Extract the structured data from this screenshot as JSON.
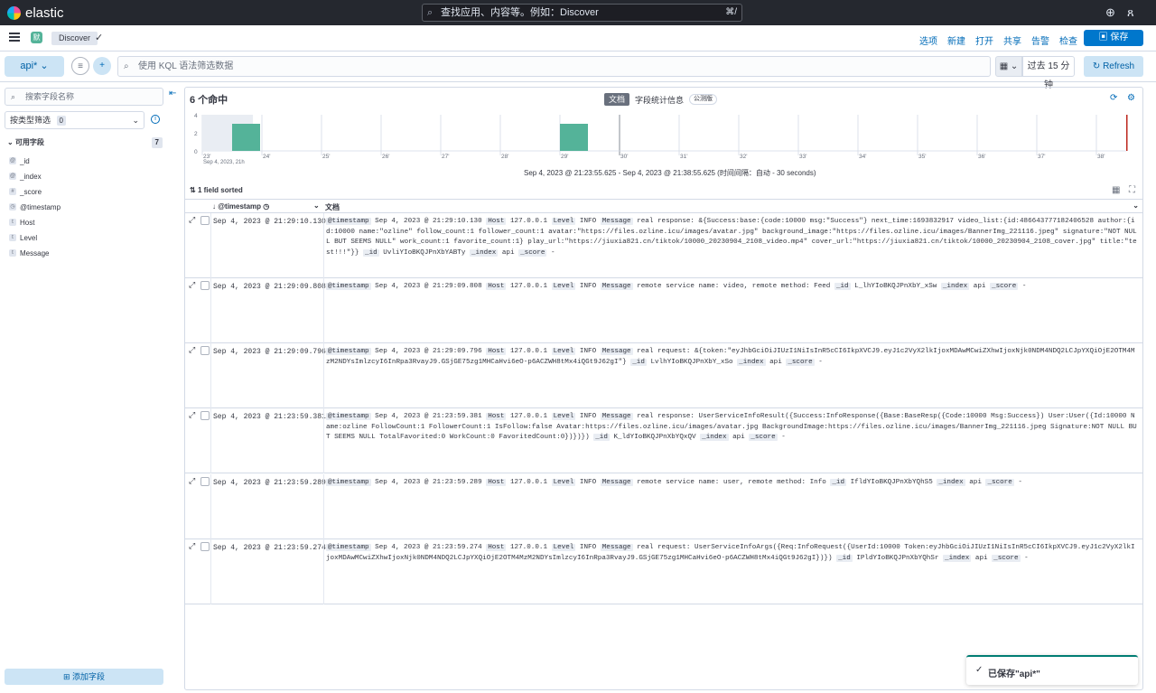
{
  "topbar": {
    "logo_text": "elastic",
    "search_placeholder": "查找应用、内容等。例如：Discover",
    "search_shortcut": "⌘/"
  },
  "appbar": {
    "space_letter": "默",
    "breadcrumb": "Discover",
    "menu": [
      "选项",
      "新建",
      "打开",
      "共享",
      "告警",
      "检查"
    ],
    "save_label": "保存"
  },
  "querybar": {
    "data_view": "api*",
    "kql_placeholder": "使用 KQL 语法筛选数据",
    "time_range": "过去 15 分钟",
    "refresh_label": "Refresh"
  },
  "sidebar": {
    "search_placeholder": "搜索字段名称",
    "filter_by_type": "按类型筛选",
    "filter_count": "0",
    "available_label": "可用字段",
    "available_count": "7",
    "fields": [
      {
        "type": "id",
        "name": "_id"
      },
      {
        "type": "id",
        "name": "_index"
      },
      {
        "type": "#",
        "name": "_score"
      },
      {
        "type": "cal",
        "name": "@timestamp"
      },
      {
        "type": "t",
        "name": "Host"
      },
      {
        "type": "t",
        "name": "Level"
      },
      {
        "type": "t",
        "name": "Message"
      }
    ],
    "add_field_label": "添加字段"
  },
  "results": {
    "hits_label": "6 个命中",
    "tab_documents": "文档",
    "tab_field_stats": "字段统计信息",
    "beta_badge": "公测版",
    "interval_text": "Sep 4, 2023 @ 21:23:55.625 - Sep 4, 2023 @ 21:38:55.625  (时间间隔：自动 - 30 seconds)",
    "sorted_label": "1 field sorted",
    "col_timestamp": "@timestamp",
    "col_document": "文档"
  },
  "chart_data": {
    "type": "bar",
    "categories": [
      "23'",
      "24'",
      "25'",
      "26'",
      "27'",
      "28'",
      "29'",
      "30'",
      "31'",
      "32'",
      "33'",
      "34'",
      "35'",
      "36'",
      "37'",
      "38'"
    ],
    "first_tick_sublabel": "Sep 4, 2023, 21h",
    "bars": [
      {
        "x": "21:23:30",
        "value": 3
      },
      {
        "x": "21:29:00",
        "value": 3
      }
    ],
    "y_ticks": [
      "0",
      "2",
      "4"
    ],
    "ylim": [
      0,
      4
    ],
    "bar_color": "#54b399"
  },
  "rows": [
    {
      "timestamp": "Sep 4, 2023 @ 21:29:10.130",
      "ts_val": "Sep 4, 2023 @ 21:29:10.130",
      "host": "127.0.0.1",
      "level": "INFO",
      "message": "real response: &{Success:base:{code:10000 msg:\"Success\"} next_time:1693832917 video_list:{id:486643777182406528 author:{id:10000 name:\"ozline\" follow_count:1 follower_count:1 avatar:\"https://files.ozline.icu/images/avatar.jpg\" background_image:\"https://files.ozline.icu/images/BannerImg_221116.jpeg\" signature:\"NOT NULL BUT SEEMS NULL\" work_count:1 favorite_count:1} play_url:\"https://jiuxia821.cn/tiktok/10000_20230904_2108_video.mp4\" cover_url:\"https://jiuxia821.cn/tiktok/10000_20230904_2108_cover.jpg\" title:\"test!!!\"}}",
      "id": "UvliYIoBKQJPnXbYABTy",
      "index": "api",
      "score": "-"
    },
    {
      "timestamp": "Sep 4, 2023 @ 21:29:09.808",
      "ts_val": "Sep 4, 2023 @ 21:29:09.808",
      "host": "127.0.0.1",
      "level": "INFO",
      "message": "remote service name: video, remote method: Feed",
      "id": "L_lhYIoBKQJPnXbY_xSw",
      "index": "api",
      "score": "-"
    },
    {
      "timestamp": "Sep 4, 2023 @ 21:29:09.796",
      "ts_val": "Sep 4, 2023 @ 21:29:09.796",
      "host": "127.0.0.1",
      "level": "INFO",
      "message": "real request: &{token:\"eyJhbGciOiJIUzI1NiIsInR5cCI6IkpXVCJ9.eyJ1c2VyX2lkIjoxMDAwMCwiZXhwIjoxNjk0NDM4NDQ2LCJpYXQiOjE2OTM4MzM2NDYsImlzcyI6InRpa3RvayJ9.GSjGE75zg1MHCaHvi6eO-p6ACZWH8tMx4iQGt9J62gI\"}",
      "id": "LvlhYIoBKQJPnXbY_xSo",
      "index": "api",
      "score": "-"
    },
    {
      "timestamp": "Sep 4, 2023 @ 21:23:59.381",
      "ts_val": "Sep 4, 2023 @ 21:23:59.381",
      "host": "127.0.0.1",
      "level": "INFO",
      "message": "real response: UserServiceInfoResult({Success:InfoResponse({Base:BaseResp({Code:10000 Msg:Success}) User:User({Id:10000 Name:ozline FollowCount:1 FollowerCount:1 IsFollow:false Avatar:https://files.ozline.icu/images/avatar.jpg BackgroundImage:https://files.ozline.icu/images/BannerImg_221116.jpeg Signature:NOT NULL BUT SEEMS NULL TotalFavorited:0 WorkCount:0 FavoritedCount:0})})})",
      "id": "K_ldYIoBKQJPnXbYQxQV",
      "index": "api",
      "score": "-"
    },
    {
      "timestamp": "Sep 4, 2023 @ 21:23:59.289",
      "ts_val": "Sep 4, 2023 @ 21:23:59.289",
      "host": "127.0.0.1",
      "level": "INFO",
      "message": "remote service name: user, remote method: Info",
      "id": "IfldYIoBKQJPnXbYQhS5",
      "index": "api",
      "score": "-"
    },
    {
      "timestamp": "Sep 4, 2023 @ 21:23:59.274",
      "ts_val": "Sep 4, 2023 @ 21:23:59.274",
      "host": "127.0.0.1",
      "level": "INFO",
      "message": "real request: UserServiceInfoArgs({Req:InfoRequest({UserId:10000 Token:eyJhbGciOiJIUzI1NiIsInR5cCI6IkpXVCJ9.eyJ1c2VyX2lkIjoxMDAwMCwiZXhwIjoxNjk0NDM4NDQ2LCJpYXQiOjE2OTM4MzM2NDYsImlzcyI6InRpa3RvayJ9.GSjGE75zg1MHCaHvi6eO-p6ACZWH8tMx4iQGt9J62gI})})",
      "id": "IPldYIoBKQJPnXbYQhSr",
      "index": "api",
      "score": "-"
    }
  ],
  "doc_keys": {
    "timestamp": "@timestamp",
    "host": "Host",
    "level": "Level",
    "message": "Message",
    "id": "_id",
    "index": "_index",
    "score": "_score"
  },
  "toast": {
    "text": "已保存\"api*\""
  }
}
